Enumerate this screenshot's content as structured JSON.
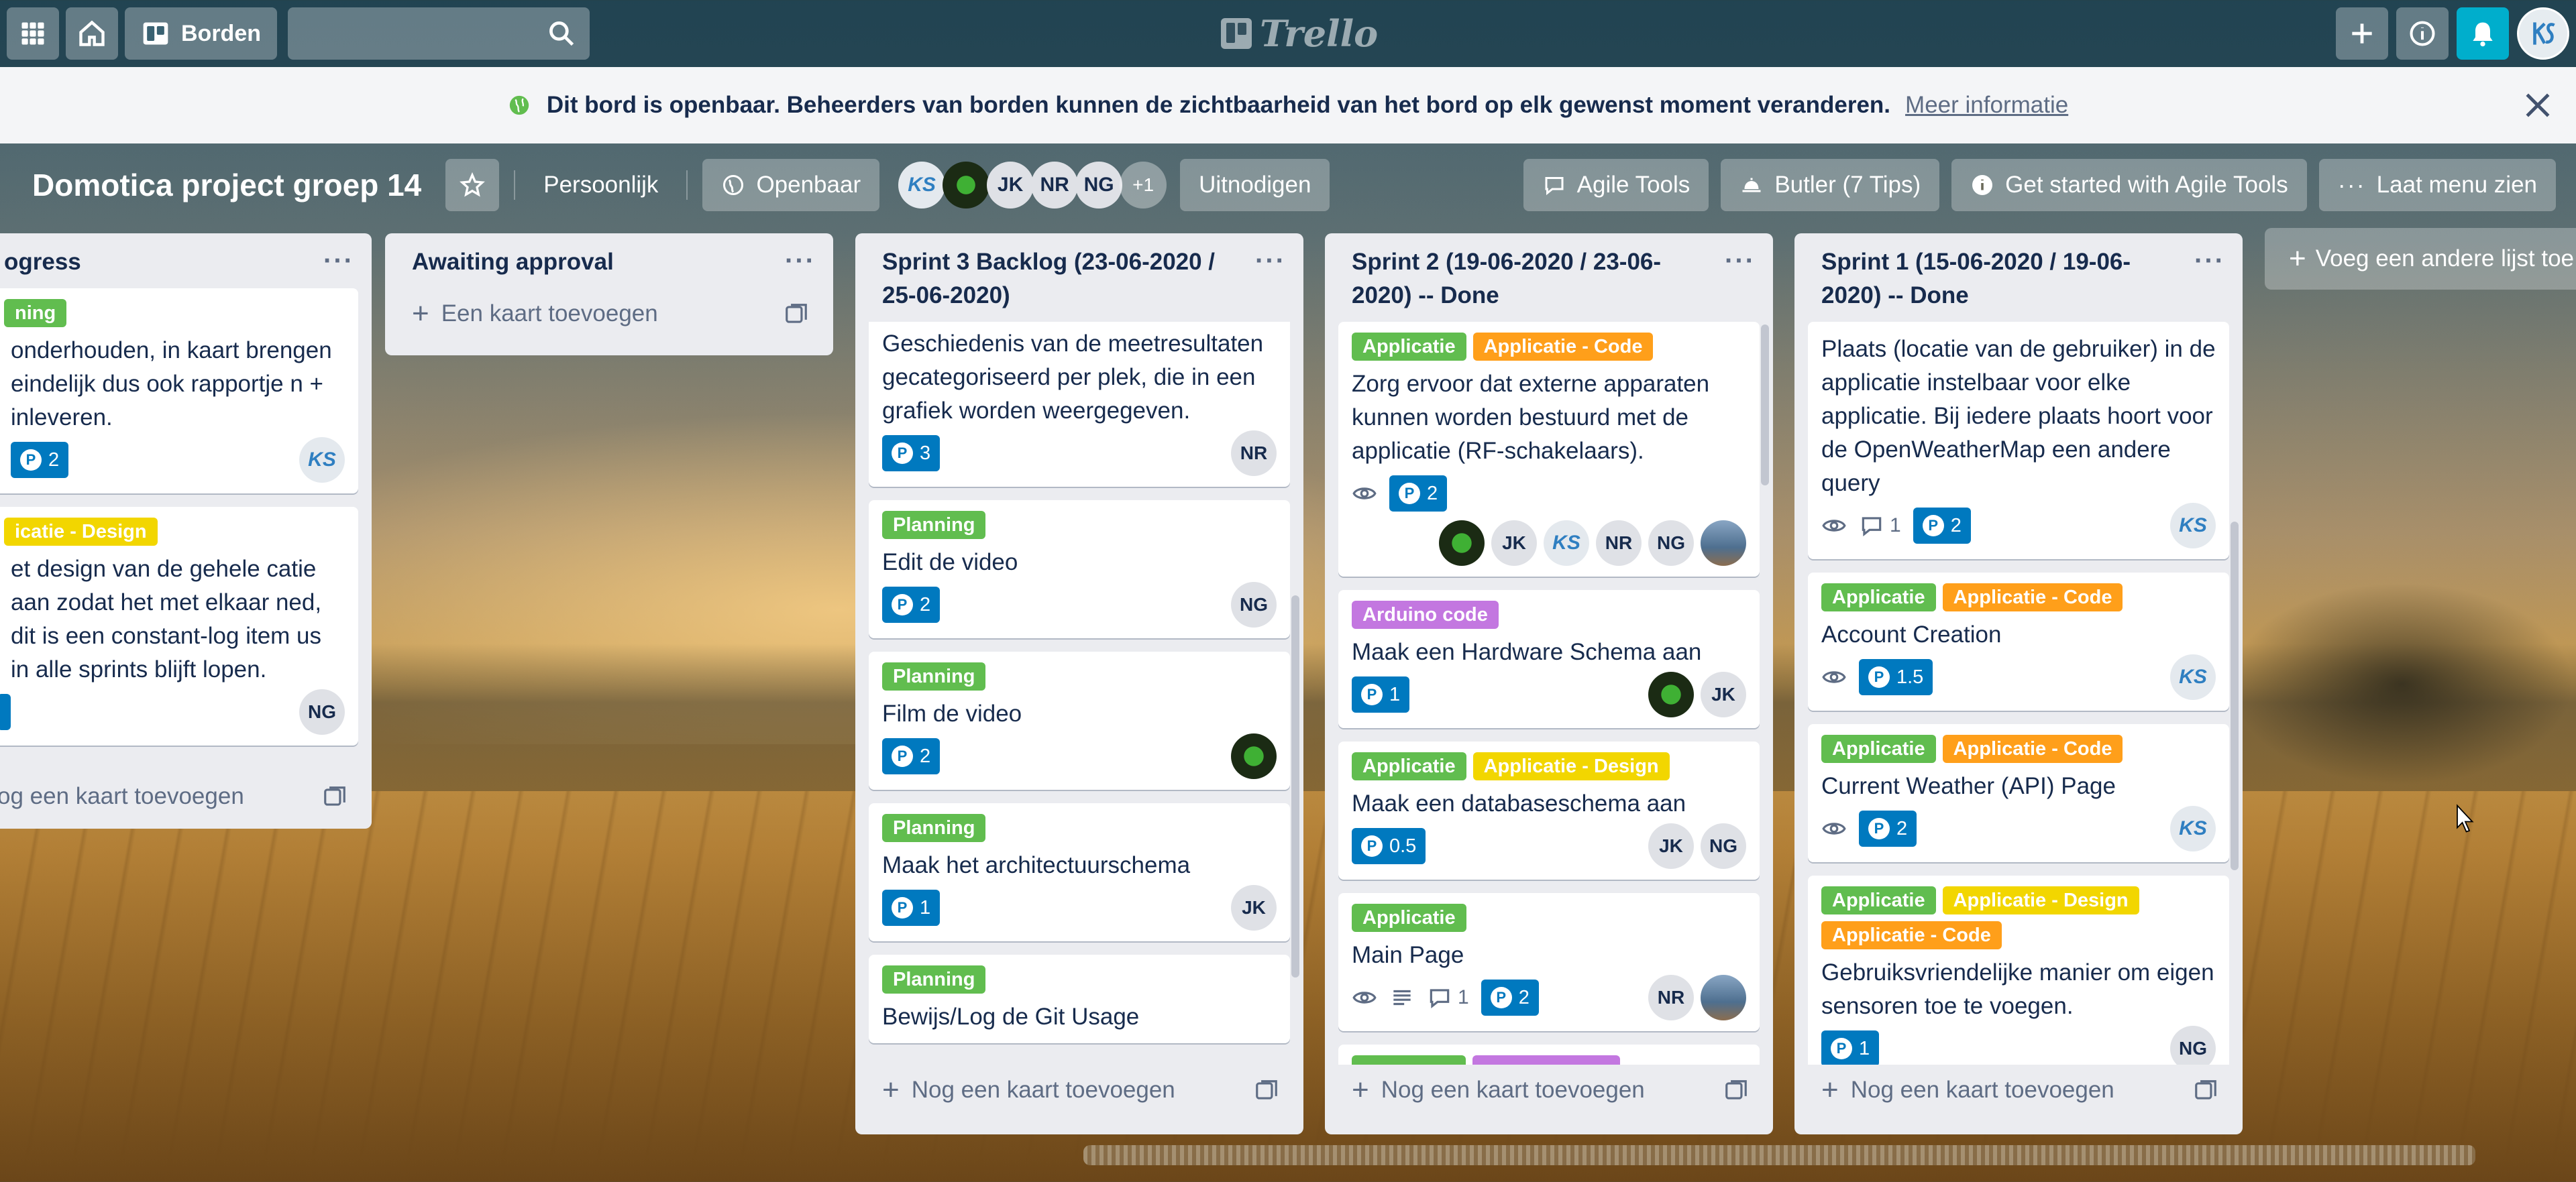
{
  "header": {
    "boards_label": "Borden",
    "search_placeholder": "",
    "logo_text": "Trello"
  },
  "banner": {
    "message": "Dit bord is openbaar. Beheerders van borden kunnen de zichtbaarheid van het bord op elk gewenst moment veranderen.",
    "link": "Meer informatie"
  },
  "board": {
    "title": "Domotica project groep 14",
    "workspace": "Persoonlijk",
    "visibility": "Openbaar",
    "members": [
      "JK",
      "NR",
      "NG"
    ],
    "members_more": "+1",
    "invite": "Uitnodigen",
    "agile_tools": "Agile Tools",
    "butler": "Butler (7 Tips)",
    "get_started": "Get started with Agile Tools",
    "menu": "Laat menu zien"
  },
  "add_list_label": "Voeg een andere lijst toe",
  "lists": [
    {
      "title": "ogress",
      "add_label": "og een kaart toevoegen",
      "cards": [
        {
          "labels": [
            {
              "text": "ning",
              "color": "#61bd4f"
            }
          ],
          "title": "onderhouden, in kaart brengen eindelijk dus ook rapportje n + inleveren.",
          "points": "2",
          "members": [
            "KS"
          ]
        },
        {
          "labels": [
            {
              "text": "icatie - Design",
              "color": "#f2d600"
            }
          ],
          "title": "et design van de gehele catie aan zodat het met elkaar ned, dit is een constant-log item us in alle sprints blijft lopen.",
          "points": "",
          "members": [
            "NG"
          ]
        }
      ]
    },
    {
      "title": "Awaiting approval",
      "add_label": "Een kaart toevoegen",
      "cards": []
    },
    {
      "title": "Sprint 3 Backlog (23-06-2020 / 25-06-2020)",
      "add_label": "Nog een kaart toevoegen",
      "cards": [
        {
          "title": "Geschiedenis van de meetresultaten gecategoriseerd per plek, die in een grafiek worden weergegeven.",
          "points": "3",
          "members": [
            "NR"
          ]
        },
        {
          "labels": [
            {
              "text": "Planning",
              "color": "#61bd4f"
            }
          ],
          "title": "Edit de video",
          "points": "2",
          "members": [
            "NG"
          ]
        },
        {
          "labels": [
            {
              "text": "Planning",
              "color": "#61bd4f"
            }
          ],
          "title": "Film de video",
          "points": "2",
          "members": [
            "plant"
          ]
        },
        {
          "labels": [
            {
              "text": "Planning",
              "color": "#61bd4f"
            }
          ],
          "title": "Maak het architectuurschema",
          "points": "1",
          "members": [
            "JK"
          ]
        },
        {
          "labels": [
            {
              "text": "Planning",
              "color": "#61bd4f"
            }
          ],
          "title": "Bewijs/Log de Git Usage",
          "points": "",
          "members": []
        }
      ]
    },
    {
      "title": "Sprint 2 (19-06-2020 / 23-06-2020) -- Done",
      "add_label": "Nog een kaart toevoegen",
      "cards": [
        {
          "labels": [
            {
              "text": "Applicatie",
              "color": "#61bd4f"
            },
            {
              "text": "Applicatie - Code",
              "color": "#ff9f1a"
            }
          ],
          "title": "Zorg ervoor dat externe apparaten kunnen worden bestuurd met de applicatie (RF-schakelaars).",
          "points": "2",
          "members": [
            "plant",
            "JK",
            "KS",
            "NR",
            "NG",
            "photo"
          ]
        },
        {
          "labels": [
            {
              "text": "Arduino code",
              "color": "#c377e0"
            }
          ],
          "title": "Maak een Hardware Schema aan",
          "points": "1",
          "members": [
            "plant",
            "JK"
          ]
        },
        {
          "labels": [
            {
              "text": "Applicatie",
              "color": "#61bd4f"
            },
            {
              "text": "Applicatie - Design",
              "color": "#f2d600"
            }
          ],
          "title": "Maak een databaseschema aan",
          "points": "0.5",
          "members": [
            "JK",
            "NG"
          ]
        },
        {
          "labels": [
            {
              "text": "Applicatie",
              "color": "#61bd4f"
            }
          ],
          "title": "Main Page",
          "comments": "1",
          "points": "2",
          "members": [
            "NR",
            "photo"
          ]
        }
      ]
    },
    {
      "title": "Sprint 1 (15-06-2020 / 19-06-2020) -- Done",
      "add_label": "Nog een kaart toevoegen",
      "cards": [
        {
          "title": "Plaats (locatie van de gebruiker) in de applicatie instelbaar voor elke applicatie. Bij iedere plaats hoort voor de OpenWeatherMap een andere query",
          "comments": "1",
          "points": "2",
          "members": [
            "KS"
          ]
        },
        {
          "labels": [
            {
              "text": "Applicatie",
              "color": "#61bd4f"
            },
            {
              "text": "Applicatie - Code",
              "color": "#ff9f1a"
            }
          ],
          "title": "Account Creation",
          "points": "1.5",
          "members": [
            "KS"
          ]
        },
        {
          "labels": [
            {
              "text": "Applicatie",
              "color": "#61bd4f"
            },
            {
              "text": "Applicatie - Code",
              "color": "#ff9f1a"
            }
          ],
          "title": "Current Weather (API) Page",
          "points": "2",
          "members": [
            "KS"
          ]
        },
        {
          "labels": [
            {
              "text": "Applicatie",
              "color": "#61bd4f"
            },
            {
              "text": "Applicatie - Design",
              "color": "#f2d600"
            },
            {
              "text": "Applicatie - Code",
              "color": "#ff9f1a"
            }
          ],
          "title": "Gebruiksvriendelijke manier om eigen sensoren toe te voegen.",
          "points": "1",
          "members": [
            "NG"
          ]
        }
      ]
    }
  ]
}
